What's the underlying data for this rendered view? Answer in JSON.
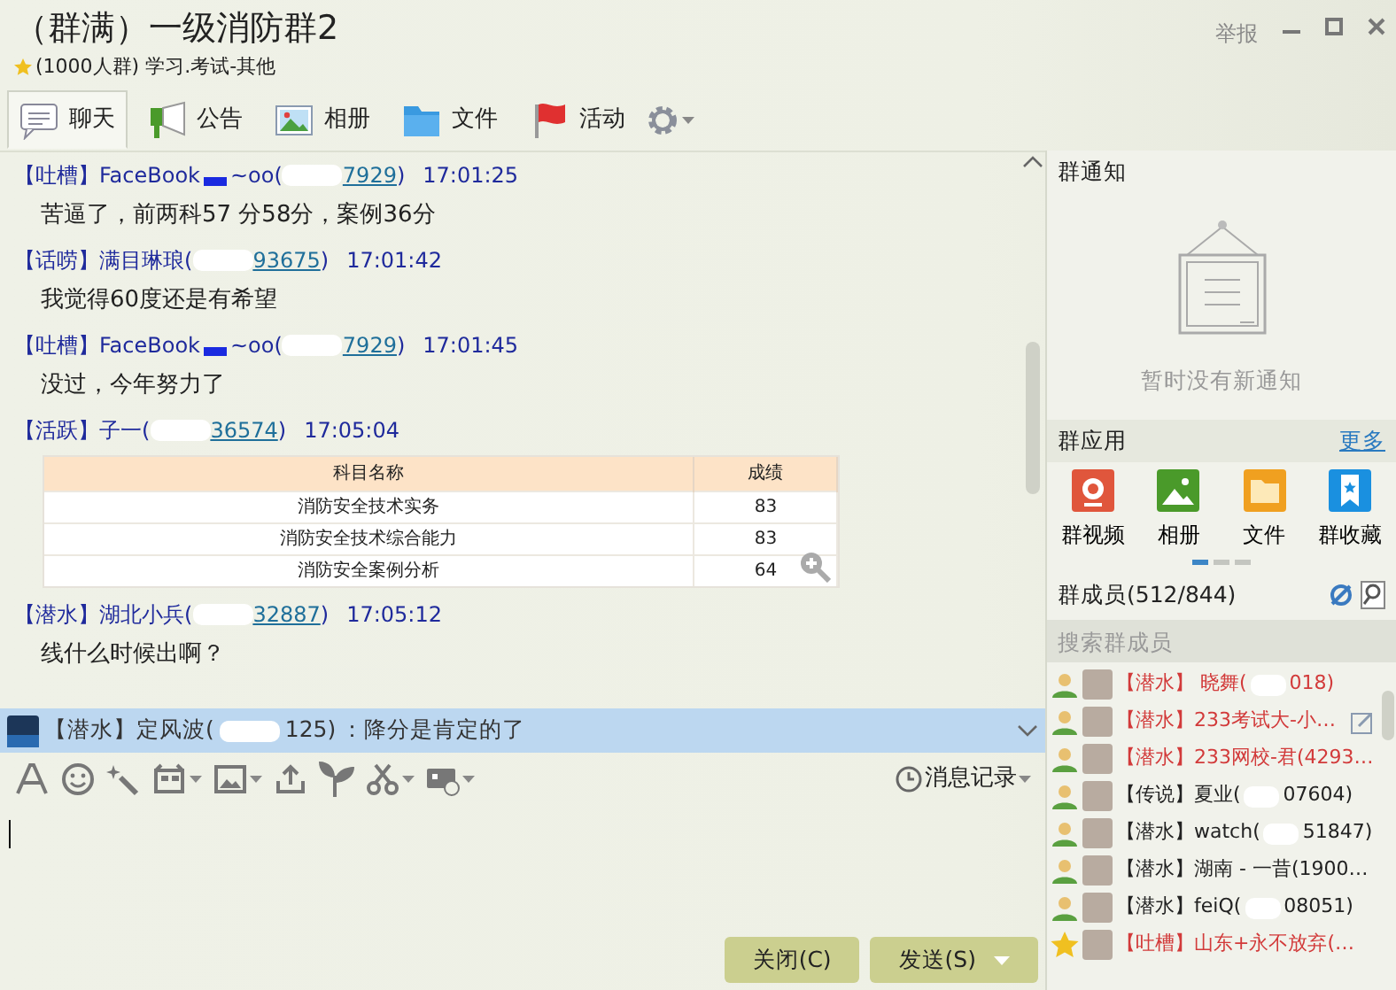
{
  "window": {
    "title": "（群满）一级消防群2",
    "subtitle": "(1000人群) 学习.考试-其他",
    "report": "举报"
  },
  "tabs": [
    {
      "label": "聊天",
      "selected": true
    },
    {
      "label": "公告",
      "selected": false
    },
    {
      "label": "相册",
      "selected": false
    },
    {
      "label": "文件",
      "selected": false
    },
    {
      "label": "活动",
      "selected": false
    }
  ],
  "messages": [
    {
      "kind": "text",
      "tag": "【吐槽】",
      "name": "FaceBook",
      "badge": true,
      "name_tail": "~oo(",
      "id": "7929",
      "id_close": ")",
      "time": "17:01:25",
      "text": "苦逼了，前两科57 分58分，案例36分"
    },
    {
      "kind": "text",
      "tag": "【话唠】",
      "name": "满目琳琅(",
      "id": "93675",
      "id_close": ")",
      "time": "17:01:42",
      "text": "我觉得60度还是有希望"
    },
    {
      "kind": "text",
      "tag": "【吐槽】",
      "name": "FaceBook",
      "badge": true,
      "name_tail": "~oo(",
      "id": "7929",
      "id_close": ")",
      "time": "17:01:45",
      "text": "没过，今年努力了"
    },
    {
      "kind": "table",
      "tag": "【活跃】",
      "name": "子一(",
      "id": "36574",
      "id_close": ")",
      "time": "17:05:04",
      "table": {
        "columns": [
          "科目名称",
          "成绩"
        ],
        "rows": [
          [
            "消防安全技术实务",
            "83"
          ],
          [
            "消防安全技术综合能力",
            "83"
          ],
          [
            "消防安全案例分析",
            "64"
          ]
        ]
      }
    },
    {
      "kind": "text",
      "tag": "【潜水】",
      "name": "湖北小兵(",
      "id": "32887",
      "id_close": ")",
      "time": "17:05:12",
      "text": "线什么时候出啊？"
    }
  ],
  "banner": {
    "tag": "【潜水】",
    "name": "定风波(",
    "id_end": "125)",
    "text": "：降分是肯定的了"
  },
  "history": "消息记录",
  "buttons": [
    {
      "label": "关闭(C)",
      "menu": false
    },
    {
      "label": "发送(S)",
      "menu": true
    }
  ],
  "notice": {
    "title": "群通知",
    "empty": "暂时没有新通知"
  },
  "apps": {
    "title": "群应用",
    "more": "更多",
    "items": [
      {
        "label": "群视频",
        "kind": "video"
      },
      {
        "label": "相册",
        "kind": "album"
      },
      {
        "label": "文件",
        "kind": "folder"
      },
      {
        "label": "群收藏",
        "kind": "bookmark"
      }
    ],
    "pager": [
      {
        "selected": true
      },
      {
        "selected": false
      },
      {
        "selected": false
      }
    ]
  },
  "members": {
    "title": "群成员(512/844)",
    "placeholder": "搜索群成员",
    "items": [
      {
        "kind": "member",
        "tag_name": "【潜水】 晓舞(",
        "name_end": "018)",
        "color": "#d23a3a"
      },
      {
        "kind": "member",
        "tag_name": "【潜水】233考试大-小…",
        "color": "#d23a3a",
        "edit": true
      },
      {
        "kind": "member",
        "tag_name": "【潜水】233网校-君(4293…",
        "color": "#d23a3a"
      },
      {
        "kind": "member",
        "tag_name": "【传说】夏业(",
        "name_end": "07604)",
        "color": "#222222"
      },
      {
        "kind": "member",
        "tag_name": "【潜水】watch(",
        "name_end": "51847)",
        "color": "#222222"
      },
      {
        "kind": "member",
        "tag_name": "【潜水】湖南 - 一昔(1900…",
        "color": "#222222"
      },
      {
        "kind": "member",
        "tag_name": "【潜水】feiQ(",
        "name_end": "08051)",
        "color": "#222222"
      },
      {
        "kind": "owner",
        "tag_name": "【吐槽】山东+永不放弃(…",
        "color": "#d23a3a"
      }
    ]
  }
}
